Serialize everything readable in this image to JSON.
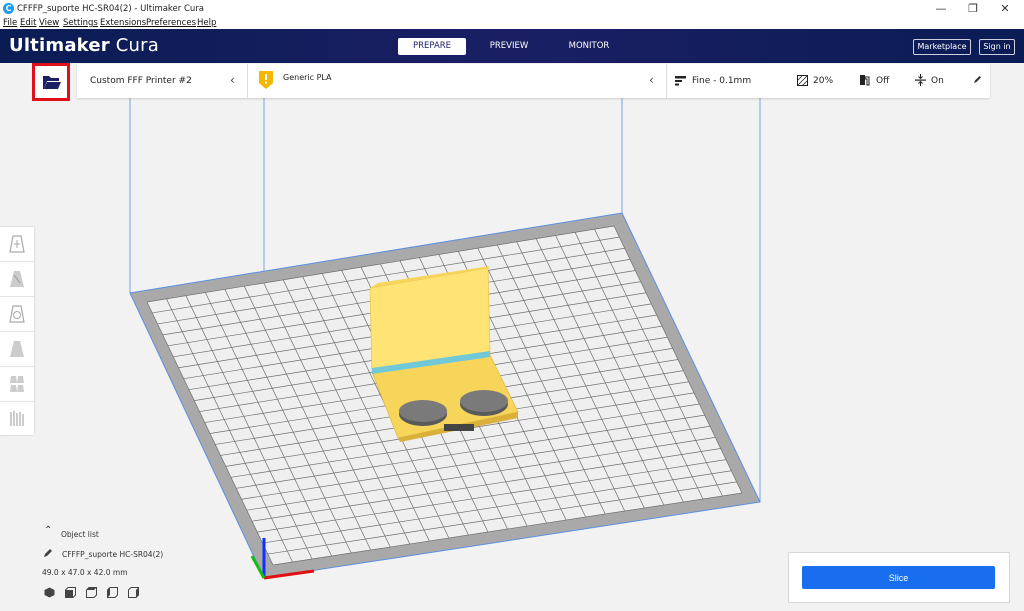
{
  "window": {
    "title": "CFFFP_suporte HC-SR04(2) - Ultimaker Cura",
    "controls": {
      "minimize": "—",
      "restore": "❐",
      "close": "✕"
    }
  },
  "menu": {
    "file": "File",
    "edit": "Edit",
    "view": "View",
    "settings": "Settings",
    "extensions": "Extensions",
    "preferences": "Preferences",
    "help": "Help"
  },
  "header": {
    "logo_bold": "Ultimaker",
    "logo_light": "Cura",
    "tabs": {
      "prepare": "PREPARE",
      "preview": "PREVIEW",
      "monitor": "MONITOR"
    },
    "active_tab": "PREPARE",
    "marketplace": "Marketplace",
    "signin": "Sign in"
  },
  "toolbar": {
    "printer": "Custom FFF Printer #2",
    "material": "Generic PLA",
    "profile": "Fine - 0.1mm",
    "infill": "20%",
    "support": "Off",
    "adhesion": "On"
  },
  "object": {
    "list_label": "Object list",
    "name": "CFFFP_suporte HC-SR04(2)",
    "dimensions": "49.0 x 47.0 x 42.0 mm"
  },
  "slice": {
    "label": "Slice"
  },
  "colors": {
    "header_bg": "#1a1f64",
    "accent_blue": "#196ef0",
    "model_yellow": "#ffe26a",
    "highlight_red": "#e0101a",
    "material_badge": "#f5b800"
  }
}
